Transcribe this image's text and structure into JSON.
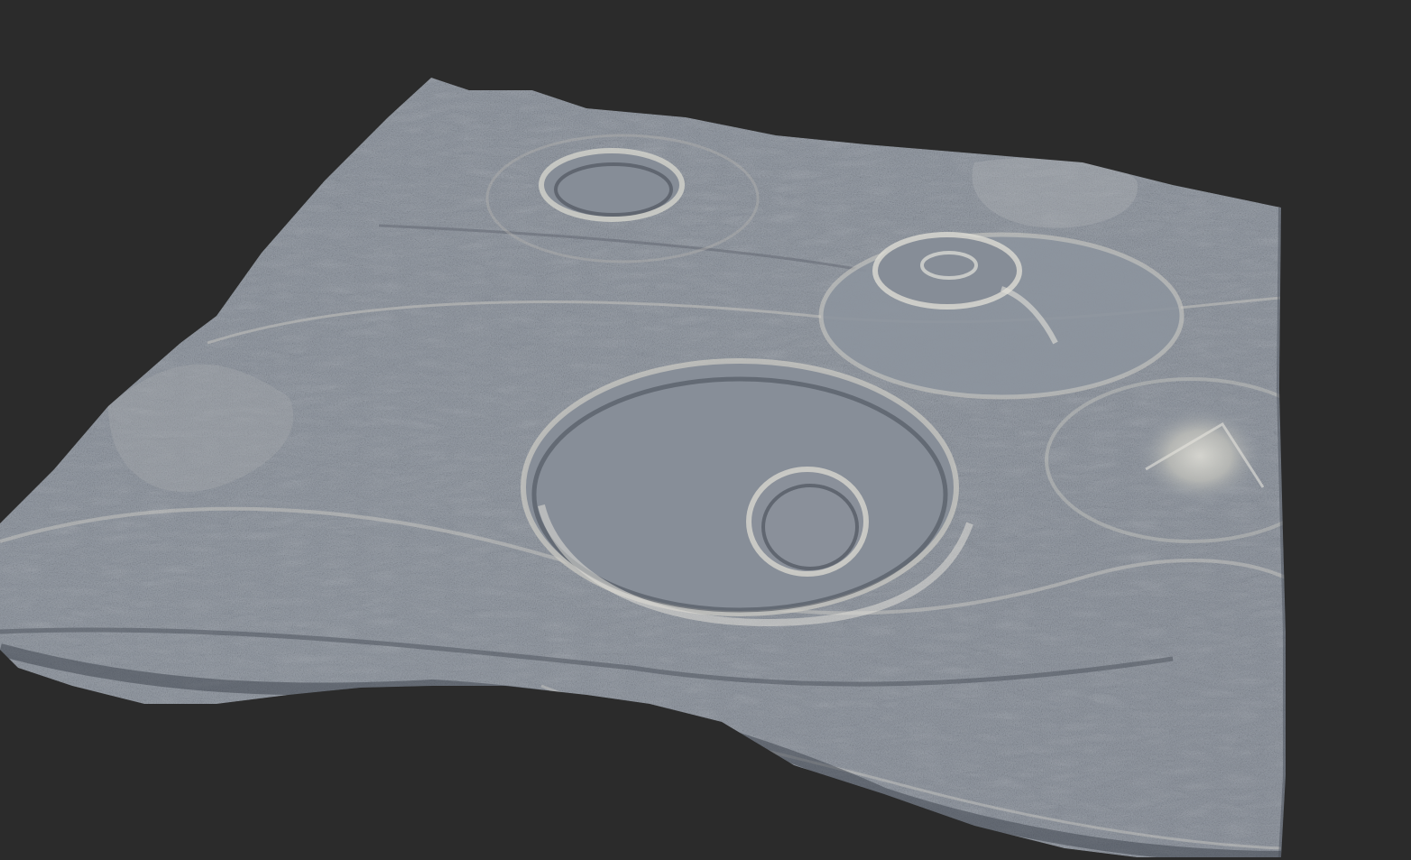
{
  "scene": {
    "background_color": "#2b2b2b",
    "subject": "heightmap-terrain-render",
    "material_colors": {
      "base": "#8b929c",
      "highlight": "#d4d3cc",
      "shadow": "#3d434c",
      "mid": "#9aa0a8"
    },
    "features": [
      "crater-large-center",
      "crater-small-inner",
      "crater-top-left",
      "crater-top-right",
      "mountain-peak-right",
      "ridge-bands"
    ]
  }
}
